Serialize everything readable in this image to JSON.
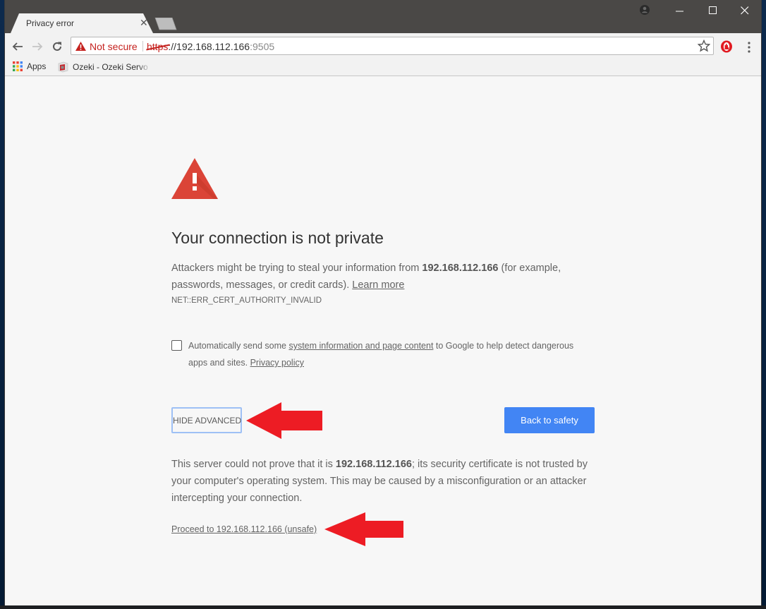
{
  "browser": {
    "tab": {
      "title": "Privacy error",
      "close_glyph": "✕"
    },
    "window_controls": {
      "minimize": "—",
      "maximize": "☐",
      "close": "✕"
    },
    "toolbar": {
      "back_glyph": "←",
      "forward_glyph": "→",
      "reload_glyph": "↻",
      "security_label": "Not secure",
      "url_scheme": "https",
      "url_sep": "://",
      "url_host": "192.168.112.166",
      "url_port": ":9505"
    },
    "bookmarks": [
      {
        "label": "Apps",
        "icon": "apps-grid-icon"
      },
      {
        "label": "Ozeki - Ozeki Servo M",
        "icon": "ozeki-favicon"
      }
    ],
    "extension_icon": "red-hand-blocker-icon"
  },
  "page": {
    "headline": "Your connection is not private",
    "intro": {
      "before": "Attackers might be trying to steal your information from ",
      "host": "192.168.112.166",
      "after": " (for example, passwords, messages, or credit cards). ",
      "learn_more": "Learn more"
    },
    "error_code": "NET::ERR_CERT_AUTHORITY_INVALID",
    "report": {
      "before": "Automatically send some ",
      "link1": "system information and page content",
      "middle": " to Google to help detect dangerous apps and sites. ",
      "link2": "Privacy policy",
      "checked": false
    },
    "buttons": {
      "hide_advanced": "HIDE ADVANCED",
      "back_to_safety": "Back to safety"
    },
    "details": {
      "before": "This server could not prove that it is ",
      "host": "192.168.112.166",
      "after": "; its security certificate is not trusted by your computer's operating system. This may be caused by a misconfiguration or an attacker intercepting your connection."
    },
    "proceed_link": "Proceed to 192.168.112.166 (unsafe)"
  },
  "colors": {
    "warning_red": "#db4437",
    "annotation_arrow": "#ed1c24",
    "primary_blue": "#4285f4",
    "focus_ring": "#9ec0f5"
  }
}
